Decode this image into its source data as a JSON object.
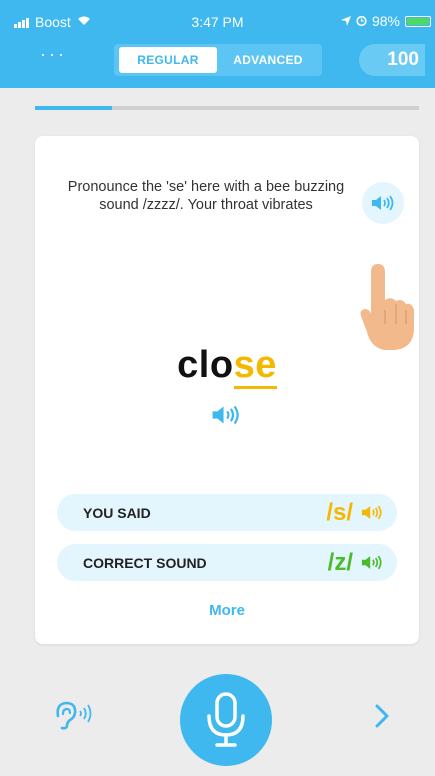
{
  "status_bar": {
    "carrier": "Boost",
    "time": "3:47 PM",
    "battery": "98%",
    "battery_level": 0.98
  },
  "header": {
    "menu_dots": "···",
    "modes": [
      "REGULAR",
      "ADVANCED"
    ],
    "selected_mode": "REGULAR",
    "score": "100"
  },
  "progress": {
    "value": 0.2
  },
  "card": {
    "instruction": "Pronounce the 'se' here with a bee buzzing sound /zzzz/. Your throat vibrates",
    "word_prefix": "clo",
    "word_highlight": "se",
    "you_said": {
      "label": "YOU SAID",
      "sound": "/s/"
    },
    "correct_sound": {
      "label": "CORRECT SOUND",
      "sound": "/z/"
    },
    "more_link": "More"
  },
  "colors": {
    "accent": "#3fb8ef",
    "highlight": "#f5b800",
    "correct": "#4cbb2a",
    "pill_bg": "#e3f5fd"
  },
  "icons": [
    "ear-icon",
    "microphone-icon",
    "chevron-right-icon",
    "speaker-icon",
    "hand-pointer-icon"
  ]
}
